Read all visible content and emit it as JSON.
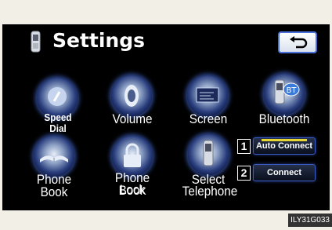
{
  "header": {
    "title": "Settings",
    "back_icon": "back-arrow-icon",
    "phone_icon": "mobile-phone-icon"
  },
  "items": {
    "speed_dial": {
      "label_line1": "Speed",
      "label_line2": "Dial",
      "icon": "dial-icon"
    },
    "volume": {
      "label": "Volume",
      "icon": "speaker-icon"
    },
    "screen": {
      "label": "Screen",
      "icon": "screen-icon"
    },
    "bluetooth": {
      "label": "Bluetooth",
      "icon": "bluetooth-phone-icon"
    },
    "phone_book": {
      "label": "Phone Book",
      "icon": "book-icon"
    },
    "phone_book_lock": {
      "label_line1": "Phone Book",
      "label_line2": "Lock",
      "icon": "padlock-icon"
    },
    "select_telephone": {
      "label_line1": "Select",
      "label_line2": "Telephone",
      "icon": "mobile-phone-icon"
    }
  },
  "connect_panel": {
    "auto_connect": {
      "number": "1",
      "label": "Auto Connect",
      "indicator_color": "#e6d633"
    },
    "connect": {
      "number": "2",
      "label": "Connect"
    }
  },
  "reference_code": "ILY31G033",
  "colors": {
    "screen_bg": "#000000",
    "accent_blue": "#4a6fd8",
    "page_bg": "#f1efe6"
  }
}
